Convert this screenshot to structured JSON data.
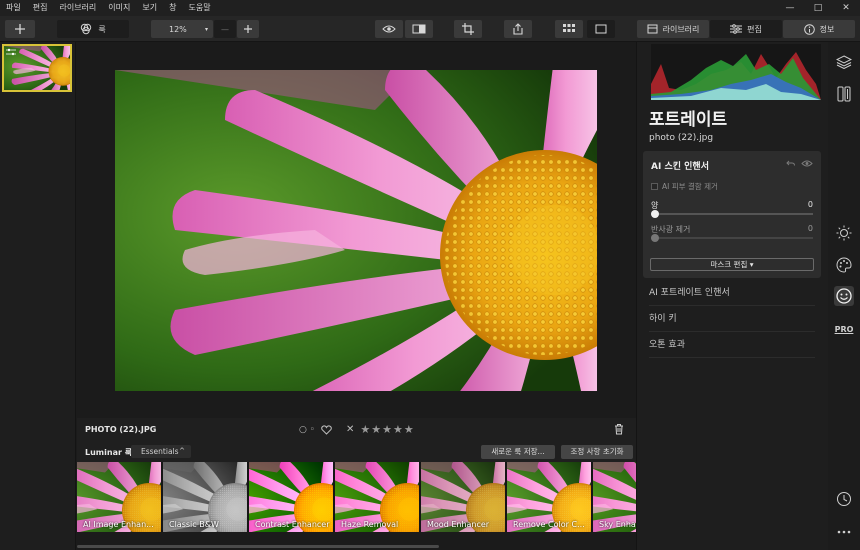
{
  "menu": [
    "파일",
    "편집",
    "라이브러리",
    "이미지",
    "보기",
    "창",
    "도움말"
  ],
  "window_controls": [
    "—",
    "□",
    "✕"
  ],
  "toolbar": {
    "looks_label": "룩",
    "zoom_value": "12%",
    "zoom_minus": "—",
    "library_tab": "라이브러리",
    "edit_tab": "편집",
    "info_tab": "정보"
  },
  "photo": {
    "filename": "PHOTO (22).JPG",
    "stars": "★★★★★",
    "flag_glyph": "○ ◦",
    "reject_glyph": "✕"
  },
  "looks": {
    "label": "Luminar 룩:",
    "collection": "Essentials",
    "save_button": "새로운 룩 저장...",
    "reset_button": "조정 사항 초기화",
    "items": [
      {
        "name": "AI Image Enhan...",
        "style": "color"
      },
      {
        "name": "Classic B&W",
        "style": "bw"
      },
      {
        "name": "Contrast Enhancer",
        "style": "color"
      },
      {
        "name": "Haze Removal",
        "style": "color"
      },
      {
        "name": "Mood Enhancer",
        "style": "soft"
      },
      {
        "name": "Remove Color C...",
        "style": "color"
      },
      {
        "name": "Sky Enha",
        "style": "color"
      }
    ]
  },
  "panel": {
    "title": "포트레이트",
    "file": "photo (22).jpg",
    "card": {
      "title": "AI 스킨 인핸서",
      "checkbox_label": "AI 피부 결함 제거",
      "amount_label": "양",
      "amount_value": "0",
      "amount_level": 0,
      "shine_label": "반사광 제거",
      "shine_value": "0",
      "shine_level": 0,
      "mask_button": "마스크 편집 ▾"
    },
    "tools": [
      "AI 포트레이트 인핸서",
      "하이 키",
      "오톤 효과"
    ]
  },
  "side_icons": [
    "layers-icon",
    "compare-icon",
    "sun-icon",
    "palette-icon",
    "face-icon",
    "pro-icon",
    "history-icon",
    "more-icon"
  ],
  "side_pro_label": "PRO",
  "colors": {
    "accent_yellow": "#d8c338",
    "petal_pink": "#e77fc6",
    "center_yellow": "#f0b81a",
    "bg_green": "#3f7d1e"
  }
}
